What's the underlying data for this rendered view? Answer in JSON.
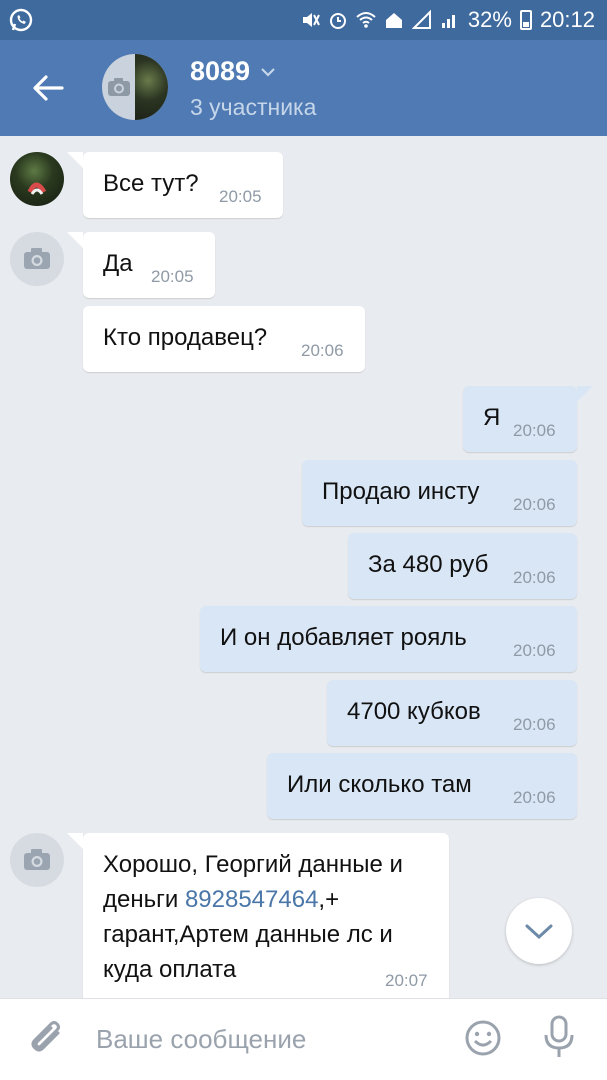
{
  "status_bar": {
    "battery": "32%",
    "time": "20:12"
  },
  "header": {
    "title": "8089",
    "subtitle": "3 участника"
  },
  "messages": [
    {
      "direction": "in",
      "text": "Все тут?",
      "time": "20:05",
      "avatar": "photo"
    },
    {
      "direction": "in",
      "text": "Да",
      "time": "20:05",
      "avatar": "camera"
    },
    {
      "direction": "in",
      "text": "Кто продавец?",
      "time": "20:06"
    },
    {
      "direction": "out",
      "text": "Я",
      "time": "20:06"
    },
    {
      "direction": "out",
      "text": "Продаю инсту",
      "time": "20:06"
    },
    {
      "direction": "out",
      "text": "За 480 руб",
      "time": "20:06"
    },
    {
      "direction": "out",
      "text": "И он добавляет рояль",
      "time": "20:06"
    },
    {
      "direction": "out",
      "text": "4700 кубков",
      "time": "20:06"
    },
    {
      "direction": "out",
      "text": "Или сколько там",
      "time": "20:06"
    },
    {
      "direction": "in",
      "avatar": "camera",
      "text_parts": [
        "Хорошо, Георгий данные и деньги ",
        "8928547464",
        ",+ гарант,Артем данные лс и куда оплата"
      ],
      "time": "20:07"
    }
  ],
  "input": {
    "placeholder": "Ваше сообщение"
  },
  "icons": {
    "back": "arrow-left-icon",
    "attach": "paperclip-icon",
    "emoji": "smiley-icon",
    "mic": "microphone-icon",
    "scroll": "chevron-down-icon"
  },
  "colors": {
    "header": "#4f7ab3",
    "status_bar": "#3f6a9e",
    "background": "#e8ebef",
    "outgoing_bubble": "#d9e6f5",
    "link": "#4a76a8"
  }
}
